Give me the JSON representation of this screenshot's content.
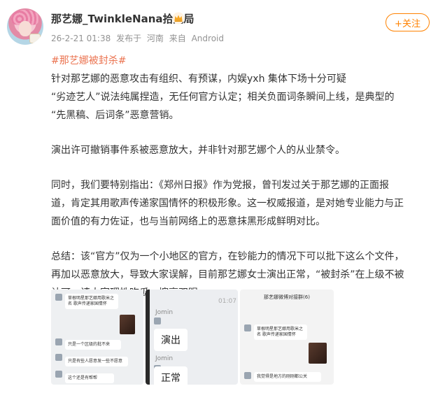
{
  "header": {
    "name": "那艺娜_TwinkleNana拾光局",
    "timestamp": "26-2-21 01:38",
    "source_prefix": "发布于",
    "location": "河南",
    "device_prefix": "来自",
    "device": "Android",
    "follow_label": "+关注"
  },
  "post": {
    "topic": "#那艺娜被封杀#",
    "lines": [
      "针对那艺娜的恶意攻击有组织、有预谋，内娱yxh 集体下场十分可疑",
      "“劣迹艺人”说法纯属捏造，无任何官方认定；相关负面词条瞬间上线，是典型的",
      "“先黑稿、后词条”恶意营销。",
      "演出许可撤销事件系被恶意放大，并非针对那艺娜个人的从业禁令。",
      "同时，我们要特别指出：《郑州日报》作为党报，曾刊发过关于那艺娜的正面报",
      "道，肯定其用歌声传递家国情怀的积极形象。这一权威报道，是对她专业能力与正",
      "面价值的有力佐证，也与当前网络上的恶意抹黑形成鲜明对比。",
      "总结：该“官方”仅为一个小地区的官方，在钞能力的情况下可以批下这么个文件，",
      "再加以恶意放大，导致大家误解，目前那艺娜女士演出正常，“被封杀”在上级不被",
      "认可，请大家理性吃瓜，擦亮双眼"
    ]
  },
  "images": {
    "pic1": {
      "messages": [
        "草根明星那艺娜用歌米之名 歌声传递家国情怀",
        "只是一个区级的批不来",
        "只是有些人愿意发一些不愿意",
        "这个还是有帮帮"
      ]
    },
    "pic2": {
      "time": "01:07",
      "sender1": "Jomin",
      "bubble1": "演出",
      "sender2": "Jomin",
      "bubble2": "正常"
    },
    "pic3": {
      "title": "那艺娜微博对接群(6)",
      "messages": [
        "草根明星那艺娜用歌米之名 歌声传递家国情怀",
        "我觉得是地方的刚刚都公关"
      ]
    }
  },
  "colors": {
    "accent": "#ff8200",
    "topic": "#eb7350",
    "meta": "#939393"
  }
}
